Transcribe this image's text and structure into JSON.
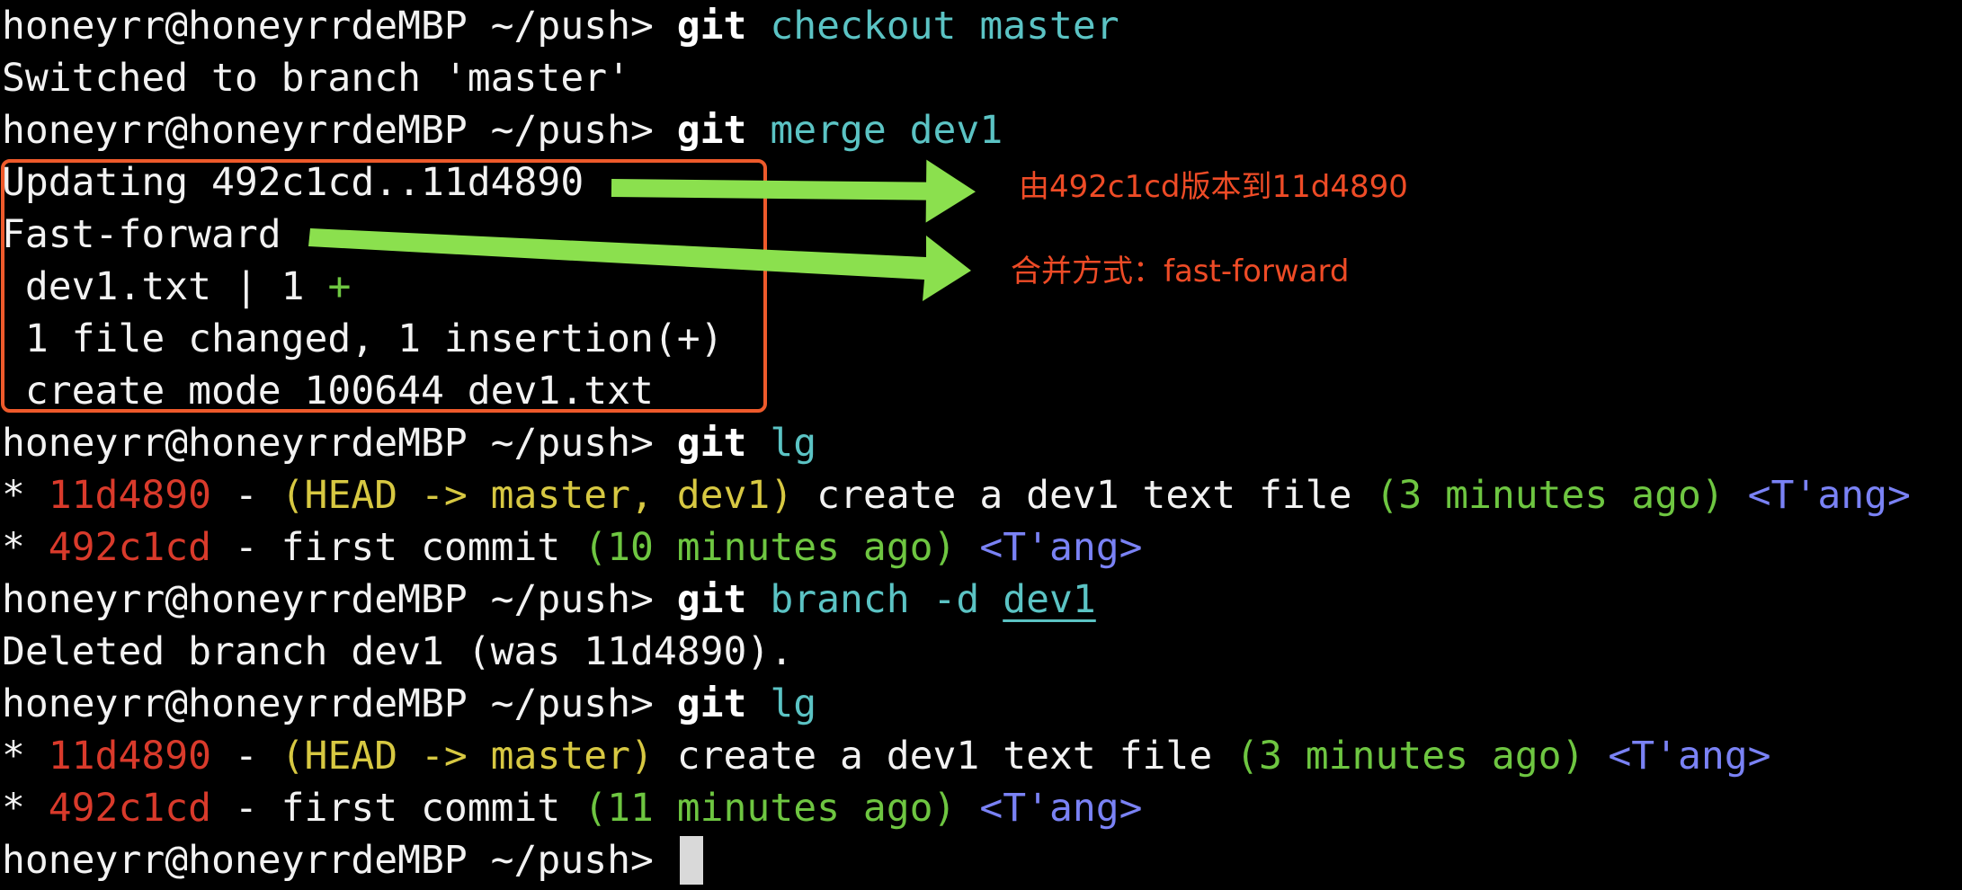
{
  "terminal": {
    "lines": [
      {
        "segments": [
          {
            "text": "honeyrr@honeyrrdeMBP ~/push> ",
            "color": "white"
          },
          {
            "text": "git",
            "color": "bold"
          },
          {
            "text": " ",
            "color": "white"
          },
          {
            "text": "checkout master",
            "color": "cyan"
          }
        ]
      },
      {
        "segments": [
          {
            "text": "Switched to branch 'master'",
            "color": "white"
          }
        ]
      },
      {
        "segments": [
          {
            "text": "honeyrr@honeyrrdeMBP ~/push> ",
            "color": "white"
          },
          {
            "text": "git",
            "color": "bold"
          },
          {
            "text": " ",
            "color": "white"
          },
          {
            "text": "merge dev1",
            "color": "cyan"
          }
        ]
      },
      {
        "segments": [
          {
            "text": "Updating 492c1cd..11d4890",
            "color": "white"
          }
        ]
      },
      {
        "segments": [
          {
            "text": "Fast-forward",
            "color": "white"
          }
        ]
      },
      {
        "segments": [
          {
            "text": " dev1.txt | 1 ",
            "color": "white"
          },
          {
            "text": "+",
            "color": "green"
          }
        ]
      },
      {
        "segments": [
          {
            "text": " 1 file changed, 1 insertion(+)",
            "color": "white"
          }
        ]
      },
      {
        "segments": [
          {
            "text": " create mode 100644 dev1.txt",
            "color": "white"
          }
        ]
      },
      {
        "segments": [
          {
            "text": "honeyrr@honeyrrdeMBP ~/push> ",
            "color": "white"
          },
          {
            "text": "git",
            "color": "bold"
          },
          {
            "text": " ",
            "color": "white"
          },
          {
            "text": "lg",
            "color": "cyan"
          }
        ]
      },
      {
        "segments": [
          {
            "text": "* ",
            "color": "white"
          },
          {
            "text": "11d4890",
            "color": "red"
          },
          {
            "text": " - ",
            "color": "white"
          },
          {
            "text": "(HEAD -> master, dev1)",
            "color": "yellow"
          },
          {
            "text": " create a dev1 text file ",
            "color": "white"
          },
          {
            "text": "(3 minutes ago)",
            "color": "green"
          },
          {
            "text": " ",
            "color": "white"
          },
          {
            "text": "<T'ang>",
            "color": "blue"
          }
        ]
      },
      {
        "segments": [
          {
            "text": "* ",
            "color": "white"
          },
          {
            "text": "492c1cd",
            "color": "red"
          },
          {
            "text": " - first commit ",
            "color": "white"
          },
          {
            "text": "(10 minutes ago)",
            "color": "green"
          },
          {
            "text": " ",
            "color": "white"
          },
          {
            "text": "<T'ang>",
            "color": "blue"
          }
        ]
      },
      {
        "segments": [
          {
            "text": "honeyrr@honeyrrdeMBP ~/push> ",
            "color": "white"
          },
          {
            "text": "git",
            "color": "bold"
          },
          {
            "text": " ",
            "color": "white"
          },
          {
            "text": "branch -d ",
            "color": "cyan"
          },
          {
            "text": "dev1",
            "color": "cyan-underline"
          }
        ]
      },
      {
        "segments": [
          {
            "text": "Deleted branch dev1 (was 11d4890).",
            "color": "white"
          }
        ]
      },
      {
        "segments": [
          {
            "text": "honeyrr@honeyrrdeMBP ~/push> ",
            "color": "white"
          },
          {
            "text": "git",
            "color": "bold"
          },
          {
            "text": " ",
            "color": "white"
          },
          {
            "text": "lg",
            "color": "cyan"
          }
        ]
      },
      {
        "segments": [
          {
            "text": "* ",
            "color": "white"
          },
          {
            "text": "11d4890",
            "color": "red"
          },
          {
            "text": " - ",
            "color": "white"
          },
          {
            "text": "(HEAD -> master)",
            "color": "yellow"
          },
          {
            "text": " create a dev1 text file ",
            "color": "white"
          },
          {
            "text": "(3 minutes ago)",
            "color": "green"
          },
          {
            "text": " ",
            "color": "white"
          },
          {
            "text": "<T'ang>",
            "color": "blue"
          }
        ]
      },
      {
        "segments": [
          {
            "text": "* ",
            "color": "white"
          },
          {
            "text": "492c1cd",
            "color": "red"
          },
          {
            "text": " - first commit ",
            "color": "white"
          },
          {
            "text": "(11 minutes ago)",
            "color": "green"
          },
          {
            "text": " ",
            "color": "white"
          },
          {
            "text": "<T'ang>",
            "color": "blue"
          }
        ]
      },
      {
        "segments": [
          {
            "text": "honeyrr@honeyrrdeMBP ~/push> ",
            "color": "white"
          }
        ]
      }
    ]
  },
  "annotations": {
    "version_note": "由492c1cd版本到11d4890",
    "merge_note": "合并方式：fast-forward"
  },
  "colors": {
    "background": "#000000",
    "text": "#f2f2f2",
    "command": "#5bc3c4",
    "hash": "#d93a2b",
    "refs": "#d7c842",
    "time": "#6ec641",
    "author": "#7a82f5",
    "annotation": "#ee4b26",
    "arrow": "#8be04e"
  }
}
